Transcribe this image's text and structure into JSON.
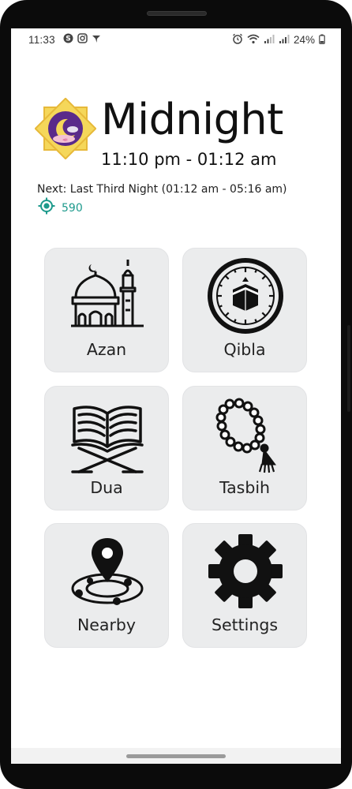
{
  "status_bar": {
    "time": "11:33",
    "battery": "24%",
    "left_icons": [
      "skype-icon",
      "instagram-icon",
      "telegram-icon"
    ],
    "right_icons": [
      "alarm-icon",
      "wifi-icon",
      "signal-icon",
      "signal-icon",
      "battery-icon"
    ]
  },
  "header": {
    "title": "Midnight",
    "time_range": "11:10 pm - 01:12 am",
    "next": "Next: Last Third Night (01:12 am - 05:16 am)",
    "location_value": "590",
    "logo_icon": "moon-star-icon"
  },
  "tiles": [
    {
      "label": "Azan",
      "icon": "mosque-icon"
    },
    {
      "label": "Qibla",
      "icon": "kaaba-compass-icon"
    },
    {
      "label": "Dua",
      "icon": "quran-icon"
    },
    {
      "label": "Tasbih",
      "icon": "prayer-beads-icon"
    },
    {
      "label": "Nearby",
      "icon": "location-pin-icon"
    },
    {
      "label": "Settings",
      "icon": "gear-icon"
    }
  ],
  "colors": {
    "accent": "#1d9a8c",
    "tile_bg": "#ebeced",
    "logo_star": "#f5d75a",
    "logo_inner": "#5a2a8a"
  }
}
